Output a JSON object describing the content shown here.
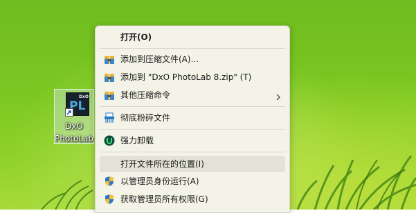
{
  "desktop_icon": {
    "caption_line1": "DxO",
    "caption_line2": "PhotoLab",
    "tile_small": "DxO",
    "tile_big": "PL"
  },
  "menu": {
    "items": [
      {
        "label": "打开(O)",
        "icon": "none"
      },
      {
        "label": "添加到压缩文件(A)...",
        "icon": "archive-icon"
      },
      {
        "label": "添加到 \"DxO PhotoLab 8.zip\" (T)",
        "icon": "archive-icon"
      },
      {
        "label": "其他压缩命令",
        "icon": "archive-icon"
      },
      {
        "label": "彻底粉碎文件",
        "icon": "shredder-icon"
      },
      {
        "label": "强力卸载",
        "icon": "uninstall-icon"
      },
      {
        "label": "打开文件所在的位置(I)",
        "icon": "none"
      },
      {
        "label": "以管理员身份运行(A)",
        "icon": "shield-icon"
      },
      {
        "label": "获取管理员所有权限(G)",
        "icon": "shield-icon"
      }
    ]
  },
  "colors": {
    "menu_background": "#f4f3e7",
    "hover_background": "#e3e2d6",
    "desktop_green": "#7cc722"
  }
}
